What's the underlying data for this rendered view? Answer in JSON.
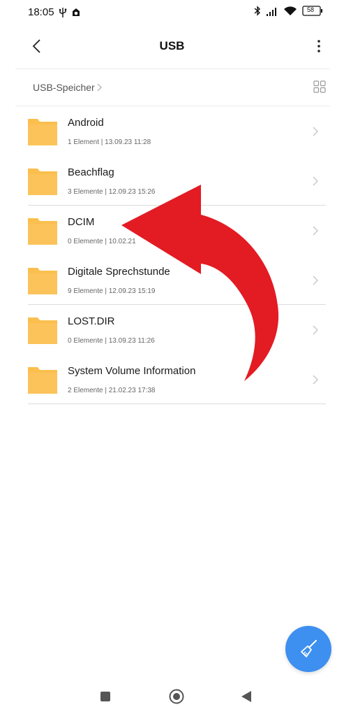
{
  "status_bar": {
    "time": "18:05",
    "battery": "58"
  },
  "app_bar": {
    "title": "USB"
  },
  "breadcrumb": {
    "root": "USB-Speicher"
  },
  "folders": [
    {
      "name": "Android",
      "meta": "1 Element  |  13.09.23 11:28"
    },
    {
      "name": "Beachflag",
      "meta": "3 Elemente  |  12.09.23 15:26"
    },
    {
      "name": "DCIM",
      "meta": "0 Elemente  |  10.02.21"
    },
    {
      "name": "Digitale Sprechstunde",
      "meta": "9 Elemente  |  12.09.23 15:19"
    },
    {
      "name": "LOST.DIR",
      "meta": "0 Elemente  |  13.09.23 11:26"
    },
    {
      "name": "System Volume Information",
      "meta": "2 Elemente  |  21.02.23 17:38"
    }
  ],
  "colors": {
    "folder": "#fbbf4e",
    "fab": "#3d8ff0",
    "annotation_arrow": "#e31b23"
  },
  "icons": {
    "status_left": [
      "usb-icon",
      "notification-icon"
    ],
    "status_right": [
      "bluetooth-icon",
      "signal-icon",
      "wifi-icon",
      "battery-icon"
    ],
    "fab": "broom-icon",
    "nav": [
      "recents-icon",
      "home-icon",
      "back-icon"
    ]
  }
}
